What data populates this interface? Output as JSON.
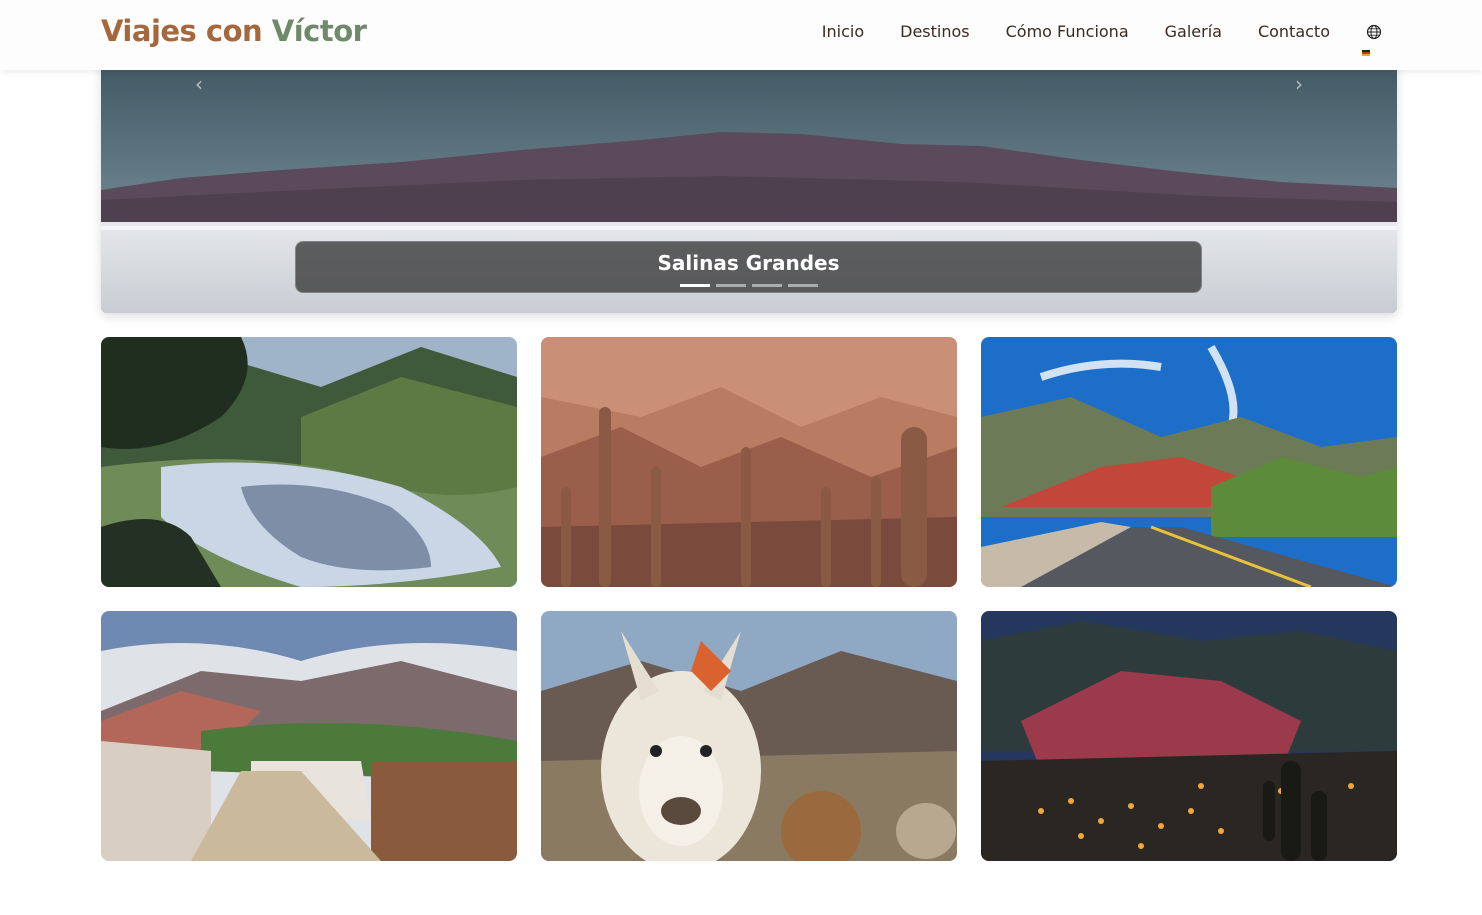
{
  "header": {
    "logo_part1": "Viajes con ",
    "logo_part2": "Víctor",
    "nav": [
      "Inicio",
      "Destinos",
      "Cómo Funciona",
      "Galería",
      "Contacto"
    ],
    "language_icon": "globe-icon"
  },
  "hero": {
    "caption": "Salinas Grandes",
    "slide_count": 4,
    "active_slide": 1,
    "prev_icon": "chevron-left-icon",
    "next_icon": "chevron-right-icon"
  },
  "gallery": {
    "cards": [
      {
        "scene": "river-valley"
      },
      {
        "scene": "cactus-canyon"
      },
      {
        "scene": "colored-mountain-road"
      },
      {
        "scene": "village-street"
      },
      {
        "scene": "llama"
      },
      {
        "scene": "night-village"
      }
    ]
  },
  "colors": {
    "logo_primary": "#a5673e",
    "logo_secondary": "#6f8a6a",
    "nav_text": "#3a2a22"
  }
}
